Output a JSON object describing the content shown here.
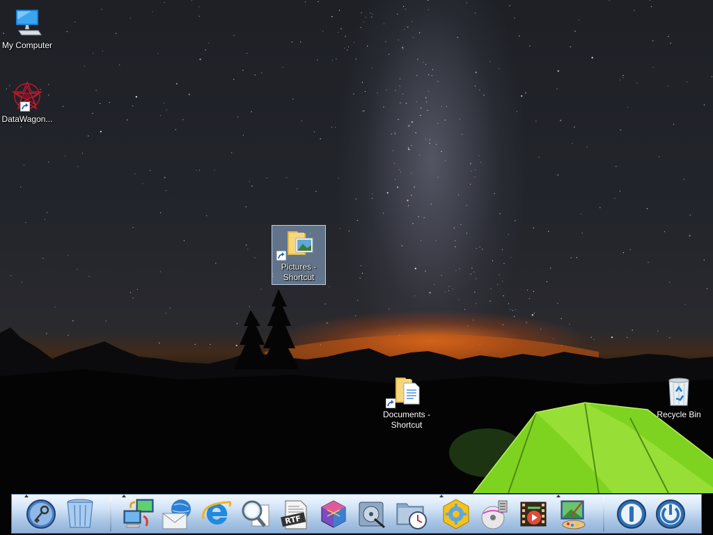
{
  "desktop": {
    "icons": [
      {
        "label": "My Computer",
        "icon": "my-computer-icon"
      },
      {
        "label": "DataWagon...",
        "icon": "datawagon-icon"
      },
      {
        "label": "Pictures - Shortcut",
        "line1": "Pictures -",
        "line2": "Shortcut",
        "icon": "pictures-shortcut-icon",
        "selected": true
      },
      {
        "label": "Documents - Shortcut",
        "line1": "Documents -",
        "line2": "Shortcut",
        "icon": "documents-shortcut-icon"
      },
      {
        "label": "Recycle Bin",
        "icon": "recycle-bin-icon"
      }
    ]
  },
  "dock": {
    "items": [
      {
        "icon": "key-search-icon",
        "has_indicator": true
      },
      {
        "icon": "trash-icon",
        "has_indicator": false
      },
      {
        "icon": "network-computers-icon",
        "has_indicator": true
      },
      {
        "icon": "mail-globe-icon",
        "has_indicator": false
      },
      {
        "icon": "internet-explorer-icon",
        "has_indicator": false
      },
      {
        "icon": "magnifier-icon",
        "has_indicator": false
      },
      {
        "icon": "rtf-document-icon",
        "has_indicator": false
      },
      {
        "icon": "cube-app-icon",
        "has_indicator": false
      },
      {
        "icon": "disk-utility-icon",
        "has_indicator": false
      },
      {
        "icon": "folder-clock-icon",
        "has_indicator": false
      },
      {
        "icon": "settings-gear-icon",
        "has_indicator": true
      },
      {
        "icon": "media-player-icon",
        "has_indicator": false
      },
      {
        "icon": "video-film-icon",
        "has_indicator": false
      },
      {
        "icon": "paint-monitor-icon",
        "has_indicator": true
      },
      {
        "icon": "logoff-icon",
        "has_indicator": false
      },
      {
        "icon": "power-icon",
        "has_indicator": false
      }
    ]
  },
  "colors": {
    "dock_top": "#f2f8ff",
    "dock_bottom": "#8fb1d9",
    "selection": "#96b4d7",
    "tent_green": "#7ed321",
    "horizon_orange": "#ff7a1e"
  }
}
